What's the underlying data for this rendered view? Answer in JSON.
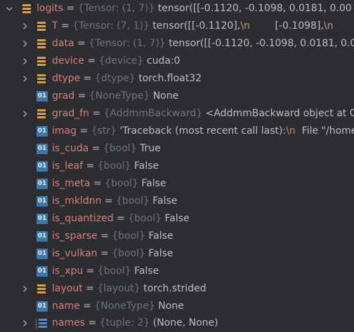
{
  "rows": [
    {
      "name": "logits",
      "type": "{Tensor: (1, 7)}",
      "value": "tensor([[-0.1120, -0.1098,  0.0181,  0.00",
      "icon": "field-icon",
      "expand": "open"
    },
    {
      "name": "T",
      "type": "{Tensor: (7, 1)}",
      "value": "tensor([[-0.1120],",
      "esc1": "\\n",
      "value2": "        [-0.1098],",
      "esc2": "\\n",
      "value3": "        [",
      "icon": "field-icon",
      "expand": "closed"
    },
    {
      "name": "data",
      "type": "{Tensor: (1, 7)}",
      "value": "tensor([[-0.1120, -0.1098,  0.0181,  0.00",
      "icon": "field-icon",
      "expand": "closed"
    },
    {
      "name": "device",
      "type": "{device}",
      "value": "cuda:0",
      "icon": "field-icon",
      "expand": "closed"
    },
    {
      "name": "dtype",
      "type": "{dtype}",
      "value": "torch.float32",
      "icon": "field-icon",
      "expand": "closed"
    },
    {
      "name": "grad",
      "type": "{NoneType}",
      "value": "None",
      "icon": "primitive-icon",
      "expand": "none"
    },
    {
      "name": "grad_fn",
      "type": "{AddmmBackward}",
      "value": "<AddmmBackward object at 0",
      "icon": "field-icon",
      "expand": "closed"
    },
    {
      "name": "imag",
      "type": "{str}",
      "value": "'Traceback (most recent call last):",
      "esc1": "\\n",
      "value2": "  File \"/home",
      "icon": "primitive-icon",
      "expand": "none"
    },
    {
      "name": "is_cuda",
      "type": "{bool}",
      "value": "True",
      "icon": "primitive-icon",
      "expand": "none"
    },
    {
      "name": "is_leaf",
      "type": "{bool}",
      "value": "False",
      "icon": "primitive-icon",
      "expand": "none"
    },
    {
      "name": "is_meta",
      "type": "{bool}",
      "value": "False",
      "icon": "primitive-icon",
      "expand": "none"
    },
    {
      "name": "is_mkldnn",
      "type": "{bool}",
      "value": "False",
      "icon": "primitive-icon",
      "expand": "none"
    },
    {
      "name": "is_quantized",
      "type": "{bool}",
      "value": "False",
      "icon": "primitive-icon",
      "expand": "none"
    },
    {
      "name": "is_sparse",
      "type": "{bool}",
      "value": "False",
      "icon": "primitive-icon",
      "expand": "none"
    },
    {
      "name": "is_vulkan",
      "type": "{bool}",
      "value": "False",
      "icon": "primitive-icon",
      "expand": "none"
    },
    {
      "name": "is_xpu",
      "type": "{bool}",
      "value": "False",
      "icon": "primitive-icon",
      "expand": "none"
    },
    {
      "name": "layout",
      "type": "{layout}",
      "value": "torch.strided",
      "icon": "field-icon",
      "expand": "closed"
    },
    {
      "name": "name",
      "type": "{NoneType}",
      "value": "None",
      "icon": "primitive-icon",
      "expand": "none"
    },
    {
      "name": "names",
      "type": "{tuple: 2}",
      "value": "(None, None)",
      "icon": "list-icon",
      "expand": "closed"
    }
  ],
  "labels": {
    "primitive_icon_text": "01",
    "equals": "="
  },
  "colors": {
    "background": "#2b2d30",
    "name": "#d97f7b",
    "type": "#6f737a",
    "value": "#bcbec4",
    "escape": "#cf8e6d",
    "primitive_icon_bg": "#3d79a8",
    "field_icon": "#d9a343"
  }
}
